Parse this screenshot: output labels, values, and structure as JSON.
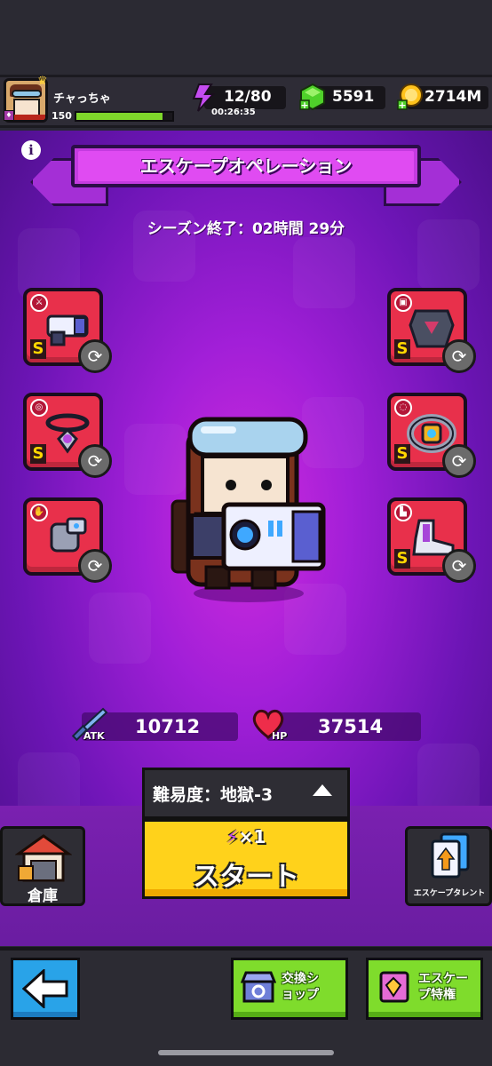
{
  "player": {
    "name": "チャっちゃ",
    "level": "150",
    "xp_fraction": 0.9
  },
  "resources": {
    "energy": "12/80",
    "energy_timer": "00:26:35",
    "gems": "5591",
    "coins": "2714M"
  },
  "banner": {
    "title": "エスケープオペレーション"
  },
  "season": {
    "text": "シーズン終了：02時間 29分"
  },
  "equipment": {
    "left": [
      {
        "slot_icon": "sword-tag-icon",
        "grade": "S",
        "item": "blaster-weapon-icon"
      },
      {
        "slot_icon": "necklace-tag-icon",
        "grade": "S",
        "item": "amulet-icon"
      },
      {
        "slot_icon": "glove-tag-icon",
        "grade": "",
        "item": "gauntlet-icon"
      }
    ],
    "right": [
      {
        "slot_icon": "armor-tag-icon",
        "grade": "S",
        "item": "chest-armor-icon"
      },
      {
        "slot_icon": "belt-tag-icon",
        "grade": "S",
        "item": "belt-icon"
      },
      {
        "slot_icon": "boot-tag-icon",
        "grade": "S",
        "item": "boots-icon"
      }
    ]
  },
  "stats": {
    "atk_label": "ATK",
    "atk_value": "10712",
    "hp_label": "HP",
    "hp_value": "37514"
  },
  "difficulty": {
    "label": "難易度：地獄-3"
  },
  "start": {
    "cost": "×1",
    "label": "スタート"
  },
  "side": {
    "warehouse": "倉庫",
    "talent": "エスケープタレント"
  },
  "bottom": {
    "exchange": "交換シ\nョップ",
    "privileges": "エスケー\nプ特権"
  },
  "colors": {
    "accent_purple": "#c43be0",
    "start_yellow": "#ffd21b",
    "slot_red": "#e8304b",
    "button_green": "#7fdc2c",
    "back_blue": "#29a3e8"
  }
}
